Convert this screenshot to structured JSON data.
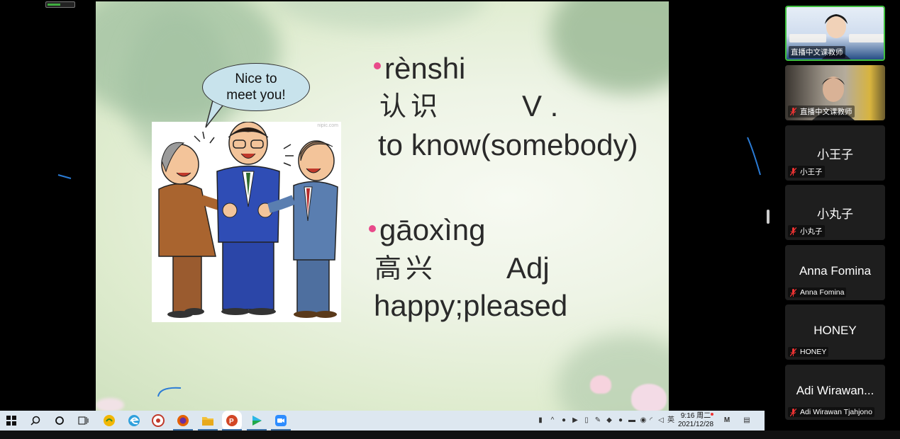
{
  "slide": {
    "bubble_text": "Nice to\nmeet you!",
    "watermark": "nipic.com",
    "vocab": [
      {
        "pinyin": "rènshi",
        "hanzi": "认识",
        "pos": "V .",
        "meaning": "to know(somebody)"
      },
      {
        "pinyin": "gāoxìng",
        "hanzi": "高兴",
        "pos": "Adj",
        "meaning": "happy;pleased"
      }
    ]
  },
  "taskbar": {
    "icons": [
      "windows-start-icon",
      "search-icon",
      "cortana-circle-icon",
      "task-view-icon",
      "app-icon-1",
      "edge-icon",
      "app-icon-3",
      "firefox-icon",
      "file-explorer-icon",
      "powerpoint-icon",
      "media-player-icon",
      "zoom-icon"
    ],
    "clock_time": "9:16 周二",
    "clock_date": "2021/12/28",
    "ime": "英"
  },
  "participants": [
    {
      "label": "直播中文课教师",
      "video": true,
      "active": true,
      "muted": false
    },
    {
      "label": "直播中文课教师",
      "video": true,
      "active": false,
      "muted": true
    },
    {
      "name": "小王子",
      "label": "小王子",
      "muted": true
    },
    {
      "name": "小丸子",
      "label": "小丸子",
      "muted": true
    },
    {
      "name": "Anna Fomina",
      "label": "Anna Fomina",
      "muted": true
    },
    {
      "name": "HONEY",
      "label": "HONEY",
      "muted": true
    },
    {
      "name": "Adi Wirawan...",
      "label": "Adi Wirawan Tjahjono",
      "muted": true
    }
  ],
  "colors": {
    "bullet": "#e84a8a",
    "active_speaker": "#3fc03f",
    "taskbar": "#dde7f0"
  }
}
